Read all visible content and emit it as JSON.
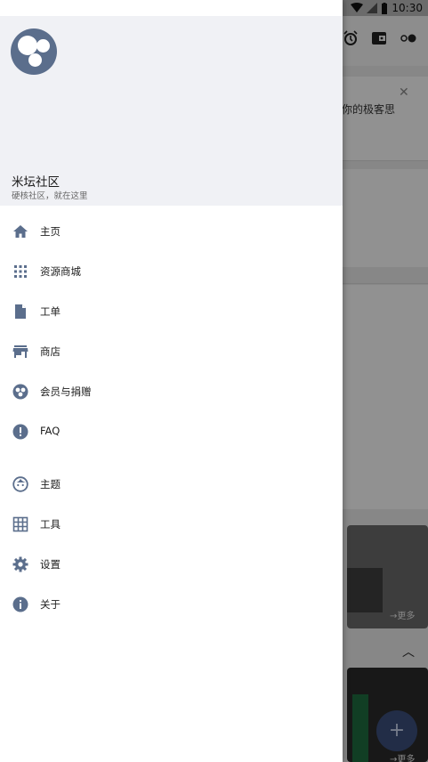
{
  "status_bar": {
    "time": "10:30"
  },
  "background": {
    "card_text": "你的极客思",
    "more_label_1": "→更多",
    "more_label_2": "→更多"
  },
  "drawer": {
    "header": {
      "title": "米坛社区",
      "subtitle": "硬核社区，就在这里"
    },
    "menu": [
      {
        "label": "主页",
        "icon": "home-icon"
      },
      {
        "label": "资源商城",
        "icon": "apps-grid-icon"
      },
      {
        "label": "工单",
        "icon": "document-icon"
      },
      {
        "label": "商店",
        "icon": "store-icon"
      },
      {
        "label": "会员与捐赠",
        "icon": "membership-icon"
      },
      {
        "label": "FAQ",
        "icon": "alert-circle-icon"
      },
      {
        "label": "主题",
        "icon": "face-icon"
      },
      {
        "label": "工具",
        "icon": "grid-icon"
      },
      {
        "label": "设置",
        "icon": "gear-icon"
      },
      {
        "label": "关于",
        "icon": "info-icon"
      }
    ]
  },
  "colors": {
    "icon": "#5b6e8c",
    "header_bg": "#f0f1f5",
    "fab": "#3b4f7a"
  }
}
